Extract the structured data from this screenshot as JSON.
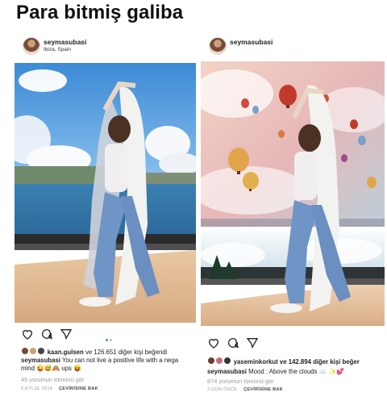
{
  "headline": "Para bitmiş galiba",
  "posts": [
    {
      "username": "seymasubasi",
      "location": "Ibiza, Spain",
      "liked_by_user": "kaan.gulsen",
      "liked_by_rest": "ve 126.651 diğer kişi beğendi",
      "caption_user": "seymasubasi",
      "caption_text": "You can not live a positive life with a nega mind 😜😅🙈 ups 😝",
      "comments": "45 yorumun tümünü gör",
      "date": "6 EYLÜL 2018",
      "translate": "ÇEVİRİSİNE BAK"
    },
    {
      "username": "seymasubasi",
      "liked_by_user": "yaseminkorkut",
      "liked_by_rest": "ve 142.894 diğer kişi beğer",
      "caption_user": "seymasubasi",
      "caption_text": "Mood : Above the clouds ☁️ ✨💕",
      "comments": "874 yorumun tümünü gör",
      "date": "2 GÜN ÖNCE",
      "translate": "ÇEVİRİSİNE BAK"
    }
  ],
  "icons": [
    "heart-icon",
    "comment-icon",
    "share-icon",
    "carousel-dots"
  ],
  "colors": {
    "sky_left": "#3f8fd6",
    "sea_left": "#2f6fa0",
    "sky_right": "#e8b7b2",
    "sea_right": "#1f3f5e"
  }
}
